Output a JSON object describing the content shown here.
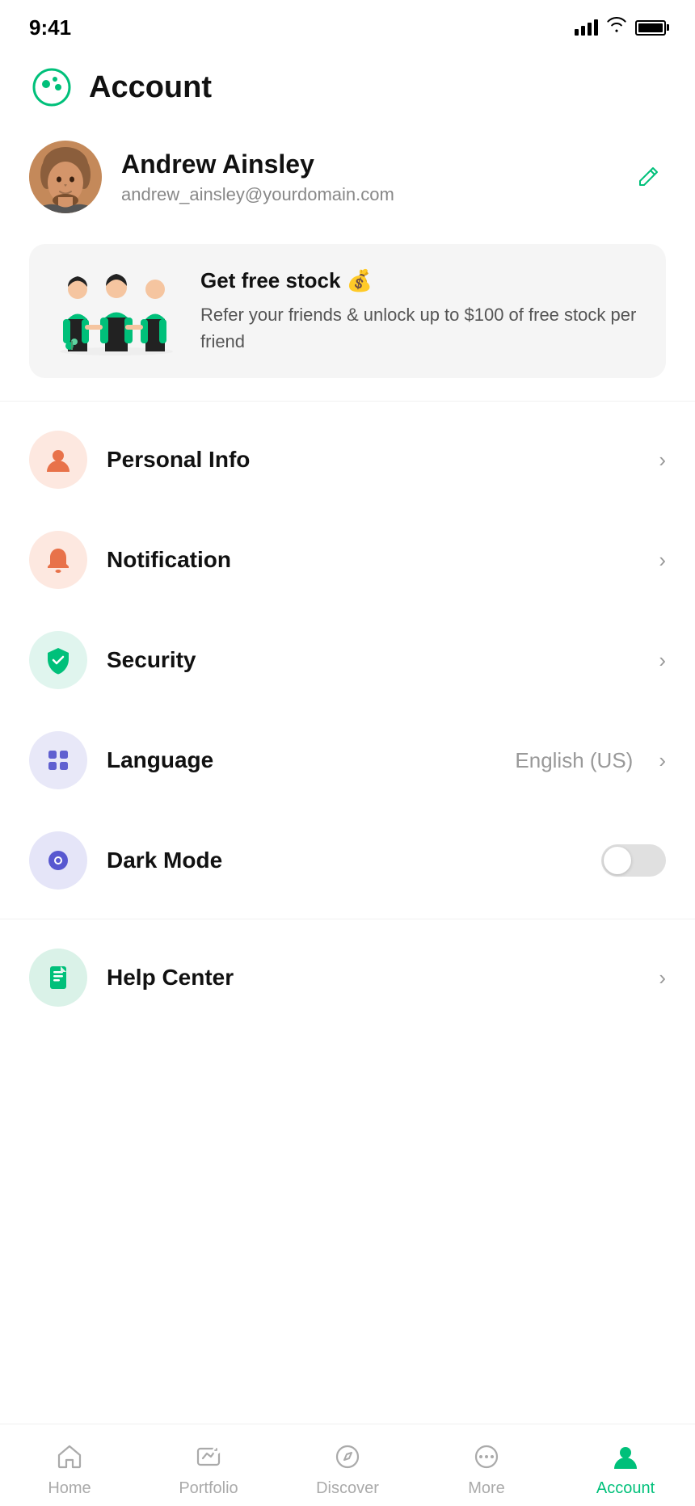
{
  "statusBar": {
    "time": "9:41"
  },
  "header": {
    "title": "Account"
  },
  "profile": {
    "name": "Andrew Ainsley",
    "email": "andrew_ainsley@yourdomain.com",
    "editLabel": "Edit"
  },
  "promo": {
    "title": "Get free stock 💰",
    "description": "Refer your friends & unlock up to $100 of free stock per friend"
  },
  "menuItems": [
    {
      "id": "personal-info",
      "label": "Personal Info",
      "iconColor": "salmon",
      "iconType": "person",
      "value": "",
      "hasChevron": true,
      "hasToggle": false
    },
    {
      "id": "notification",
      "label": "Notification",
      "iconColor": "salmon",
      "iconType": "bell",
      "value": "",
      "hasChevron": true,
      "hasToggle": false
    },
    {
      "id": "security",
      "label": "Security",
      "iconColor": "mint",
      "iconType": "shield",
      "value": "",
      "hasChevron": true,
      "hasToggle": false
    },
    {
      "id": "language",
      "label": "Language",
      "iconColor": "lavender",
      "iconType": "grid",
      "value": "English (US)",
      "hasChevron": true,
      "hasToggle": false
    },
    {
      "id": "dark-mode",
      "label": "Dark Mode",
      "iconColor": "blue-lavender",
      "iconType": "eye",
      "value": "",
      "hasChevron": false,
      "hasToggle": true
    }
  ],
  "helpItem": {
    "label": "Help Center",
    "iconColor": "green-light",
    "iconType": "doc"
  },
  "bottomNav": {
    "items": [
      {
        "id": "home",
        "label": "Home",
        "active": false
      },
      {
        "id": "portfolio",
        "label": "Portfolio",
        "active": false
      },
      {
        "id": "discover",
        "label": "Discover",
        "active": false
      },
      {
        "id": "more",
        "label": "More",
        "active": false
      },
      {
        "id": "account",
        "label": "Account",
        "active": true
      }
    ]
  },
  "colors": {
    "accent": "#00c07a",
    "salmon": "#fde8e0",
    "mint": "#e0f5ee",
    "lavender": "#e8e8f8",
    "blueLavender": "#e5e5f8",
    "greenLight": "#daf2e8"
  }
}
